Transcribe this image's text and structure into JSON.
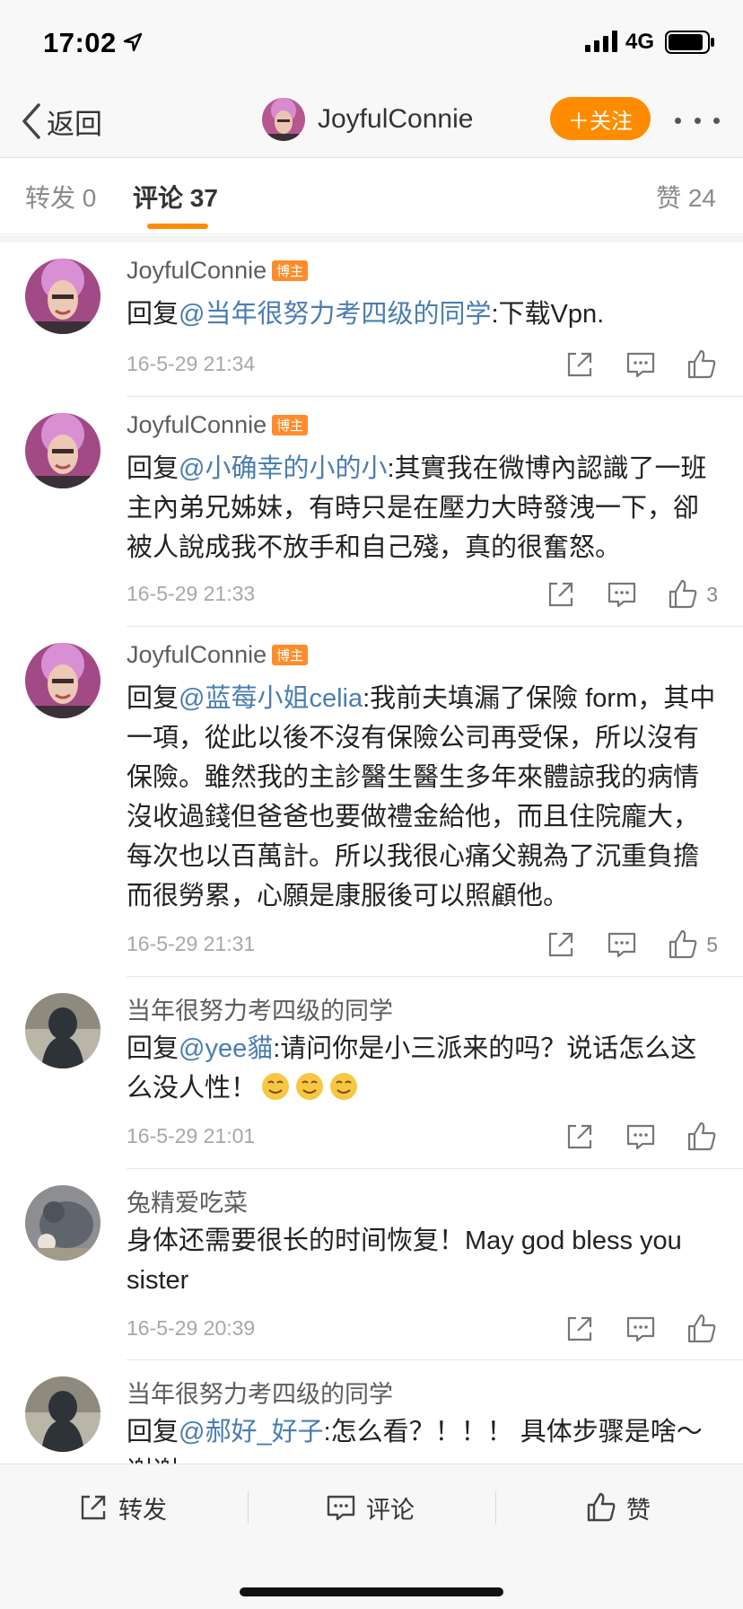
{
  "status_bar": {
    "time": "17:02",
    "network": "4G"
  },
  "nav": {
    "back_label": "返回",
    "title": "JoyfulConnie",
    "follow_label": "＋关注"
  },
  "tabs": {
    "repost": "转发 0",
    "comments": "评论 37",
    "likes": "赞 24"
  },
  "colors": {
    "accent": "#ff8c00",
    "mention": "#4a7db1",
    "badge": "#ff8c2a"
  },
  "comments": [
    {
      "user": "JoyfulConnie",
      "badge": "博主",
      "reply_prefix": "回复",
      "mention": "@当年很努力考四级的同学",
      "text": ":下载Vpn.",
      "time": "16-5-29 21:34",
      "likes": ""
    },
    {
      "user": "JoyfulConnie",
      "badge": "博主",
      "reply_prefix": "回复",
      "mention": "@小确幸的小的小",
      "text": ":其實我在微博內認識了一班主內弟兄姊妹，有時只是在壓力大時發洩一下，卻被人說成我不放手和自己殘，真的很奮怒。",
      "time": "16-5-29 21:33",
      "likes": "3"
    },
    {
      "user": "JoyfulConnie",
      "badge": "博主",
      "reply_prefix": "回复",
      "mention": "@蓝莓小姐celia",
      "text": ":我前夫填漏了保險 form，其中一項，從此以後不沒有保險公司再受保，所以沒有保險。雖然我的主診醫生醫生多年來體諒我的病情沒收過錢但爸爸也要做禮金給他，而且住院龐大，每次也以百萬計。所以我很心痛父親為了沉重負擔而很勞累，心願是康服後可以照顧他。",
      "time": "16-5-29 21:31",
      "likes": "5"
    },
    {
      "user": "当年很努力考四级的同学",
      "badge": "",
      "reply_prefix": "回复",
      "mention": "@yee貓",
      "text": ":请问你是小三派来的吗？说话怎么这么没人性！",
      "time": "16-5-29 21:01",
      "likes": ""
    },
    {
      "user": "兔精爱吃菜",
      "badge": "",
      "reply_prefix": "",
      "mention": "",
      "text": "身体还需要很长的时间恢复！May god bless you sister",
      "time": "16-5-29 20:39",
      "likes": ""
    },
    {
      "user": "当年很努力考四级的同学",
      "badge": "",
      "reply_prefix": "回复",
      "mention": "@郝好_好子",
      "text": ":怎么看？！！！ 具体步骤是啥～谢谢",
      "time": "",
      "likes": ""
    }
  ],
  "bottom_bar": {
    "repost": "转发",
    "comment": "评论",
    "like": "赞"
  }
}
